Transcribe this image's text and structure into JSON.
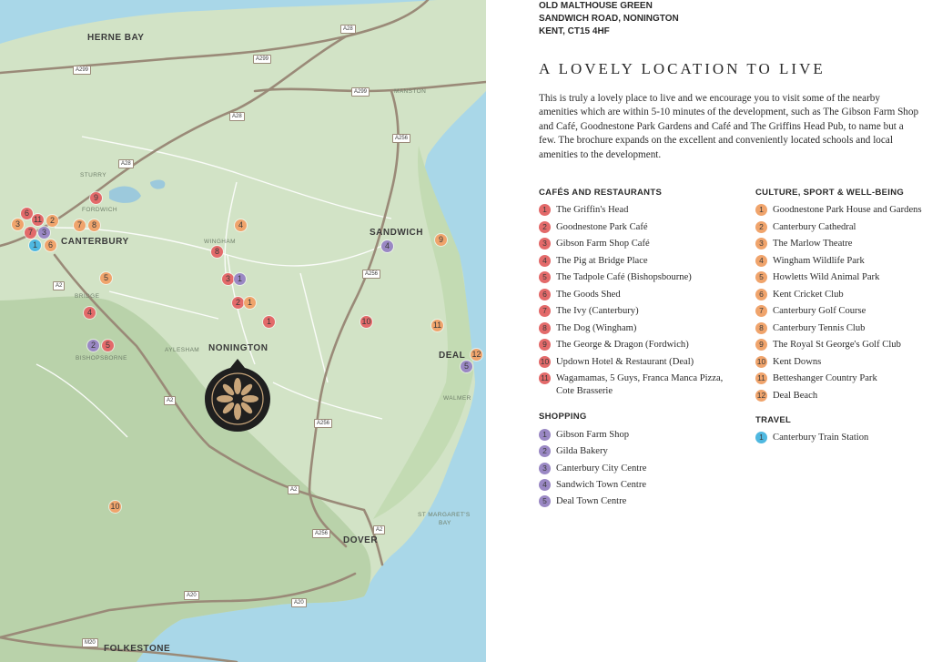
{
  "address": {
    "line1": "OLD MALTHOUSE GREEN",
    "line2": "SANDWICH ROAD, NONINGTON",
    "line3": "KENT, CT15 4HF"
  },
  "headline": "A LOVELY LOCATION TO LIVE",
  "intro": "This is truly a lovely place to live and we encourage you to visit some of the nearby amenities which are within 5-10 minutes of the development, such as The Gibson Farm Shop and Café, Goodnestone Park Gardens and Café and The Griffins Head Pub, to name but a few. The brochure expands on the excellent and conveniently located schools and local amenities to the development.",
  "colors": {
    "red": "#e36a6a",
    "orange": "#f0a46c",
    "purple": "#9a88c4",
    "blue": "#4fb8e0",
    "land": "#d2e3c6",
    "sea": "#a9d7e8",
    "road": "#9a8a78"
  },
  "categories": {
    "cafes": {
      "title": "CAFÉS AND RESTAURANTS",
      "color": "red",
      "items": [
        {
          "n": "1",
          "label": "The Griffin's Head"
        },
        {
          "n": "2",
          "label": "Goodnestone Park Café"
        },
        {
          "n": "3",
          "label": "Gibson Farm Shop Café"
        },
        {
          "n": "4",
          "label": "The Pig at Bridge Place"
        },
        {
          "n": "5",
          "label": "The Tadpole Café (Bishopsbourne)"
        },
        {
          "n": "6",
          "label": "The Goods Shed"
        },
        {
          "n": "7",
          "label": "The Ivy (Canterbury)"
        },
        {
          "n": "8",
          "label": "The Dog (Wingham)"
        },
        {
          "n": "9",
          "label": "The George & Dragon (Fordwich)"
        },
        {
          "n": "10",
          "label": "Updown Hotel & Restaurant (Deal)"
        },
        {
          "n": "11",
          "label": "Wagamamas, 5 Guys, Franca Manca Pizza, Cote Brasserie"
        }
      ]
    },
    "shopping": {
      "title": "SHOPPING",
      "color": "purple",
      "items": [
        {
          "n": "1",
          "label": "Gibson Farm Shop"
        },
        {
          "n": "2",
          "label": "Gilda Bakery"
        },
        {
          "n": "3",
          "label": "Canterbury City Centre"
        },
        {
          "n": "4",
          "label": "Sandwich Town Centre"
        },
        {
          "n": "5",
          "label": "Deal Town Centre"
        }
      ]
    },
    "culture": {
      "title": "CULTURE, SPORT & WELL-BEING",
      "color": "orange",
      "items": [
        {
          "n": "1",
          "label": "Goodnestone Park House and Gardens"
        },
        {
          "n": "2",
          "label": "Canterbury Cathedral"
        },
        {
          "n": "3",
          "label": "The Marlow Theatre"
        },
        {
          "n": "4",
          "label": "Wingham Wildlife Park"
        },
        {
          "n": "5",
          "label": "Howletts Wild Animal Park"
        },
        {
          "n": "6",
          "label": "Kent Cricket Club"
        },
        {
          "n": "7",
          "label": "Canterbury Golf Course"
        },
        {
          "n": "8",
          "label": "Canterbury Tennis Club"
        },
        {
          "n": "9",
          "label": "The Royal St George's Golf Club"
        },
        {
          "n": "10",
          "label": "Kent Downs"
        },
        {
          "n": "11",
          "label": "Betteshanger Country Park"
        },
        {
          "n": "12",
          "label": "Deal Beach"
        }
      ]
    },
    "travel": {
      "title": "TRAVEL",
      "color": "blue",
      "items": [
        {
          "n": "1",
          "label": "Canterbury Train Station"
        }
      ]
    }
  },
  "map": {
    "towns": {
      "herne_bay": "HERNE BAY",
      "canterbury": "CANTERBURY",
      "sandwich": "SANDWICH",
      "nonington": "NONINGTON",
      "deal": "DEAL",
      "dover": "DOVER",
      "folkestone": "FOLKESTONE"
    },
    "villages": {
      "sturry": "STURRY",
      "fordwich": "FORDWICH",
      "wingham": "WINGHAM",
      "bridge": "BRIDGE",
      "bishopsborne": "BISHOPSBORNE",
      "aylesham": "AYLESHAM",
      "manston": "MANSTON",
      "walmer": "WALMER",
      "st_margarets_1": "ST MARGARET'S",
      "st_margarets_2": "BAY"
    },
    "roads": {
      "a28": "A28",
      "a299": "A299",
      "a256": "A256",
      "a2": "A2",
      "a20": "A20",
      "m20": "M20"
    },
    "pins": {
      "c6": "6",
      "c11": "11",
      "c7": "7",
      "c2": "2",
      "c9": "9",
      "c8": "8",
      "c4": "4",
      "c3": "3",
      "c1": "1",
      "c10": "10",
      "c5": "5",
      "o3": "3",
      "o6": "6",
      "o7": "7",
      "o8": "8",
      "o4": "4",
      "o5": "5",
      "o1": "1",
      "o9": "9",
      "o11": "11",
      "o12": "12",
      "o10": "10",
      "p3": "3",
      "p1": "1",
      "p4": "4",
      "p2": "2",
      "p5": "5",
      "b1": "1"
    }
  }
}
